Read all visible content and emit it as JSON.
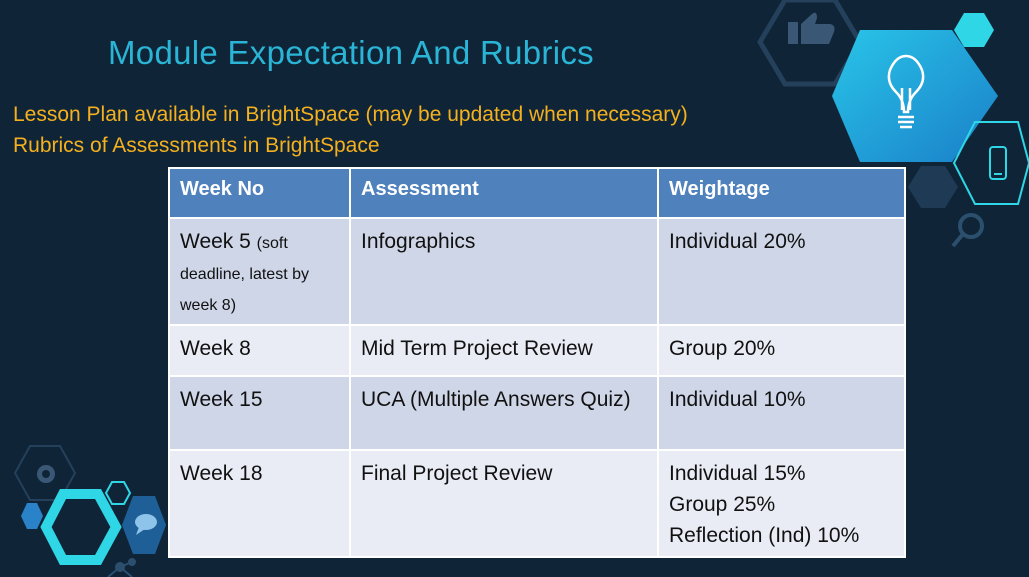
{
  "slide": {
    "title": "Module Expectation And Rubrics",
    "bullets": [
      "Lesson Plan available in BrightSpace (may be updated when necessary)",
      "Rubrics of Assessments in BrightSpace"
    ]
  },
  "table": {
    "headers": [
      "Week No",
      "Assessment",
      "Weightage"
    ],
    "rows": [
      {
        "week": "Week 5",
        "week_note": "(soft deadline, latest by week 8)",
        "assessment": "Infographics",
        "weightage": [
          "Individual 20%"
        ]
      },
      {
        "week": "Week 8",
        "assessment": "Mid Term Project Review",
        "weightage": [
          "Group 20%"
        ]
      },
      {
        "week": "Week 15",
        "assessment": "UCA (Multiple Answers Quiz)",
        "weightage": [
          "Individual 10%"
        ]
      },
      {
        "week": "Week 18",
        "assessment": "Final Project Review",
        "weightage": [
          "Individual 15%",
          "Group 25%",
          "Reflection (Ind) 10%"
        ]
      }
    ]
  },
  "decorations": {
    "icons": [
      "thumbs-up-icon",
      "lightbulb-icon",
      "smartphone-icon",
      "magnifier-icon",
      "gear-icon",
      "chat-bubble-icon",
      "network-icon"
    ],
    "colors": {
      "background": "#0f2537",
      "title": "#2ab5d6",
      "bullet_text": "#f4b01e",
      "header_fill": "#4f81bd",
      "row_fill_alt": "#cfd6e8",
      "row_fill_plain": "#e9ecf4",
      "accent_cyan": "#2fd6e6"
    }
  }
}
